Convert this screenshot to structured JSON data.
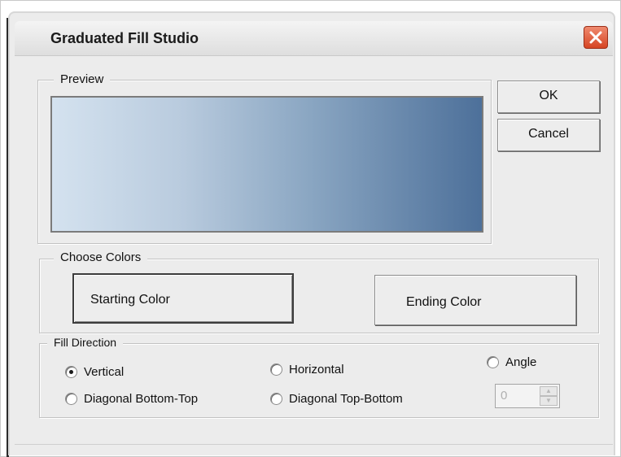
{
  "window": {
    "title": "Graduated Fill Studio",
    "close_icon": "close-icon"
  },
  "preview": {
    "legend": "Preview",
    "gradient": {
      "start_color": "#d4e2ef",
      "end_color": "#4d709a"
    }
  },
  "actions": {
    "ok_label": "OK",
    "cancel_label": "Cancel"
  },
  "colors": {
    "legend": "Choose Colors",
    "starting_label": "Starting Color",
    "ending_label": "Ending Color"
  },
  "fill_direction": {
    "legend": "Fill Direction",
    "options": [
      {
        "label": "Vertical",
        "checked": true
      },
      {
        "label": "Horizontal",
        "checked": false
      },
      {
        "label": "Angle",
        "checked": false
      },
      {
        "label": "Diagonal Bottom-Top",
        "checked": false
      },
      {
        "label": "Diagonal Top-Bottom",
        "checked": false
      }
    ],
    "angle_value": "0"
  }
}
